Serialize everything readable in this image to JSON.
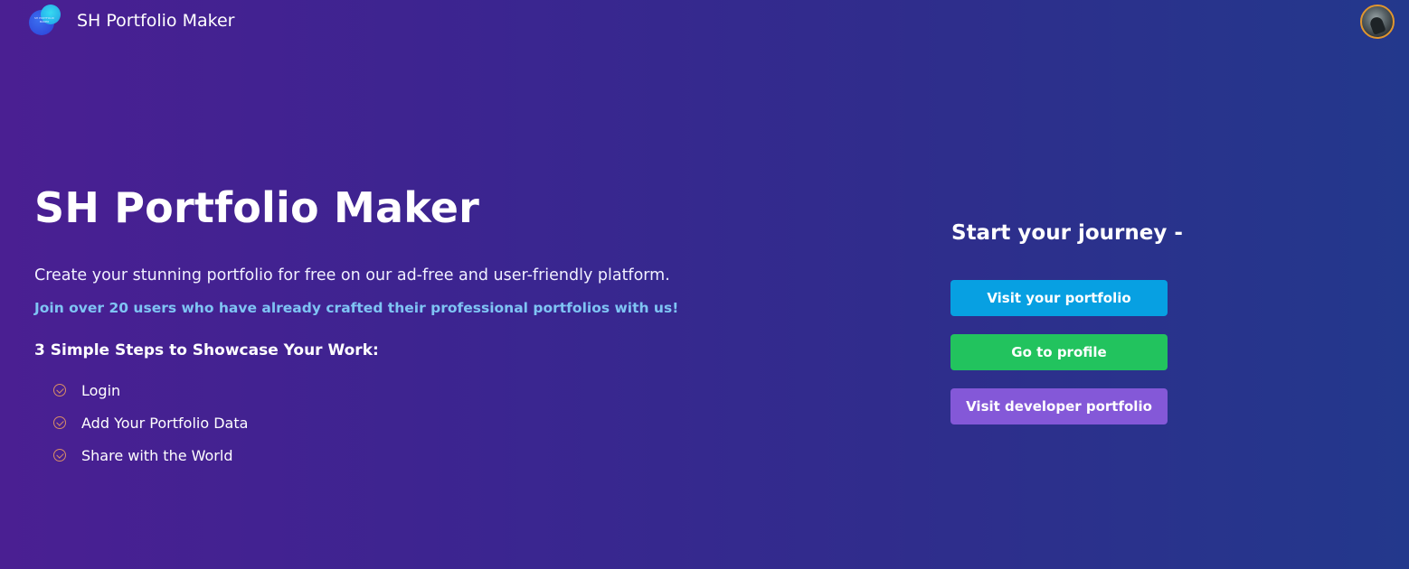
{
  "navbar": {
    "logo_text": "SH PORTFOLIO MAKER",
    "brand": "SH Portfolio Maker"
  },
  "hero": {
    "title": "SH Portfolio Maker",
    "description": "Create your stunning portfolio for free on our ad-free and user-friendly platform.",
    "join_text": "Join over 20 users who have already crafted their professional portfolios with us!",
    "steps_title": "3 Simple Steps to Showcase Your Work:",
    "steps": [
      {
        "label": "Login"
      },
      {
        "label": "Add Your Portfolio Data"
      },
      {
        "label": "Share with the World"
      }
    ]
  },
  "cta": {
    "heading": "Start your journey -",
    "visit_portfolio_label": "Visit your portfolio",
    "go_to_profile_label": "Go to profile",
    "visit_developer_label": "Visit developer portfolio"
  },
  "colors": {
    "bg_left": "#4a1f92",
    "bg_right": "#23388c",
    "accent_text": "#7fc4f4",
    "btn_portfolio": "#07a0e2",
    "btn_profile": "#22c35e",
    "btn_developer": "#8458d8",
    "check_icon": "#d98e66"
  },
  "icons": {
    "logo": "logo-icon",
    "avatar": "user-avatar",
    "step_check": "check-circle-icon"
  }
}
